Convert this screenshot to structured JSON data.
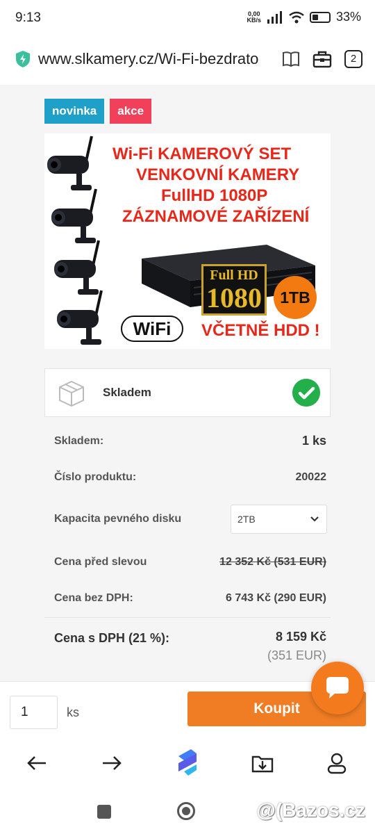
{
  "status_bar": {
    "time": "9:13",
    "net_speed_value": "0,00",
    "net_speed_unit": "KB/s",
    "battery": "33%"
  },
  "browser": {
    "url": "www.slkamery.cz/Wi-Fi-bezdrato",
    "tab_count": "2"
  },
  "badges": {
    "new": "novinka",
    "sale": "akce"
  },
  "product_image": {
    "line1": "Wi-Fi  KAMEROVÝ SET",
    "line2": "VENKOVNÍ KAMERY",
    "line3": "FullHD 1080P",
    "line4": "ZÁZNAMOVÉ ZAŘÍZENÍ",
    "fullhd_label": "Full HD",
    "resolution_label": "1080",
    "capacity_label": "1TB",
    "wifi_label": "WiFi",
    "hdd_note": "VČETNĚ HDD !"
  },
  "stock_box": {
    "label": "Skladem"
  },
  "details": {
    "stock": {
      "label": "Skladem:",
      "value": "1 ks"
    },
    "product_number": {
      "label": "Číslo produktu:",
      "value": "20022"
    },
    "hdd_capacity": {
      "label": "Kapacita pevného disku",
      "selected": "2TB"
    },
    "price_before": {
      "label": "Cena před slevou",
      "value": "12 352 Kč (531 EUR)"
    },
    "price_no_vat": {
      "label": "Cena bez DPH:",
      "value": "6 743 Kč (290 EUR)"
    },
    "price_vat": {
      "label": "Cena s DPH (21 %):",
      "value": "8 159 Kč",
      "value_eur": "(351 EUR)"
    }
  },
  "buy_bar": {
    "quantity": "1",
    "unit": "ks",
    "buy_label": "Koupit"
  },
  "watermark": "@(Bazos.cz",
  "colors": {
    "accent": "#f07d24",
    "new_badge": "#1ea0c9",
    "sale_badge": "#f0405a",
    "in_stock": "#23b04a"
  }
}
